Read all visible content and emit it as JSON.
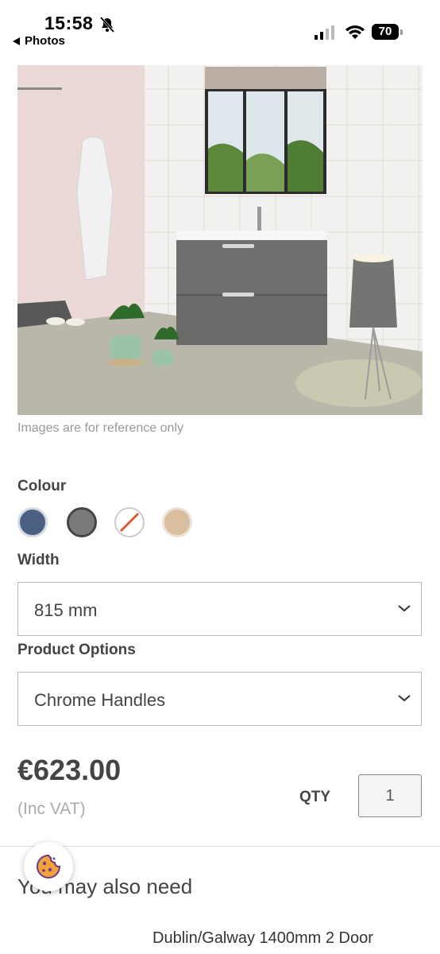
{
  "status_bar": {
    "time": "15:58",
    "back_app": "Photos",
    "battery": "70"
  },
  "product": {
    "image_caption": "Images are for reference only",
    "colour_label": "Colour",
    "colours": [
      {
        "name": "blue",
        "hex": "#4a6184"
      },
      {
        "name": "grey",
        "hex": "#7a7a78"
      },
      {
        "name": "unavailable",
        "hex": "#ffffff"
      },
      {
        "name": "oak",
        "hex": "#d9bfa0"
      }
    ],
    "width_label": "Width",
    "width_value": "815 mm",
    "options_label": "Product Options",
    "options_value": "Chrome Handles",
    "price": "€623.00",
    "vat": "(Inc VAT)",
    "qty_label": "QTY",
    "qty_value": "1"
  },
  "related": {
    "title": "You may also need",
    "first_item": "Dublin/Galway 1400mm 2 Door"
  }
}
